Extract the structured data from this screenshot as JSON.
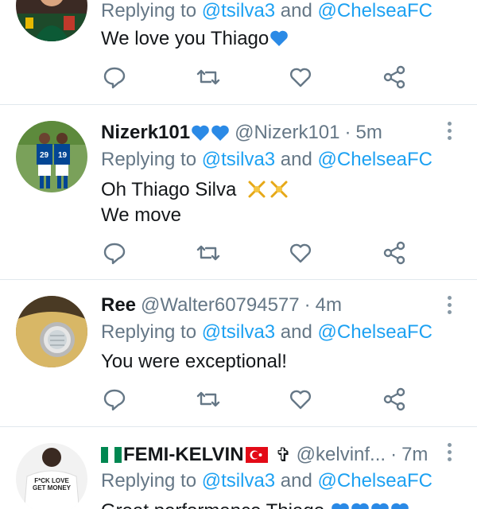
{
  "tweets": [
    {
      "reply_prefix": "Replying to ",
      "mention_1": "@tsilva3",
      "and_text": " and ",
      "mention_2": "@ChelseaFC",
      "text_lines": [
        "We love you Thiago"
      ]
    },
    {
      "display_name": "Nizerk101",
      "handle": "@Nizerk101",
      "separator": "·",
      "time": "5m",
      "reply_prefix": "Replying to ",
      "mention_1": "@tsilva3",
      "and_text": " and ",
      "mention_2": "@ChelseaFC",
      "text_lines": [
        "Oh Thiago Silva",
        "We move"
      ],
      "avatar_jerseys": [
        "29",
        "19"
      ]
    },
    {
      "display_name": "Ree",
      "handle": "@Walter60794577",
      "separator": "·",
      "time": "4m",
      "reply_prefix": "Replying to ",
      "mention_1": "@tsilva3",
      "and_text": " and ",
      "mention_2": "@ChelseaFC",
      "text_lines": [
        "You were exceptional!"
      ]
    },
    {
      "display_name": "FEMI-KELVIN",
      "handle": "@kelvinf...",
      "separator": "·",
      "time": "7m",
      "cross": "✞",
      "reply_prefix": "Replying to ",
      "mention_1": "@tsilva3",
      "and_text": " and ",
      "mention_2": "@ChelseaFC",
      "text_lines": [
        "Great performance Thiago"
      ],
      "avatar_shirt_text": [
        "F*CK LOVE",
        "GET MONEY"
      ]
    }
  ],
  "icons": {
    "reply": "reply-icon",
    "retweet": "retweet-icon",
    "like": "like-icon",
    "share": "share-icon",
    "more": "more-options-icon",
    "blue_heart": "blue-heart-emoji",
    "cartwheel": "cartwheel-emoji",
    "nigeria_flag": "nigeria-flag-emoji",
    "turkey_flag": "turkey-flag-emoji"
  },
  "colors": {
    "link": "#1da1f2",
    "muted": "#657786",
    "text": "#14171a",
    "divider": "#e1e8ed",
    "heart": "#2b8ae6"
  }
}
